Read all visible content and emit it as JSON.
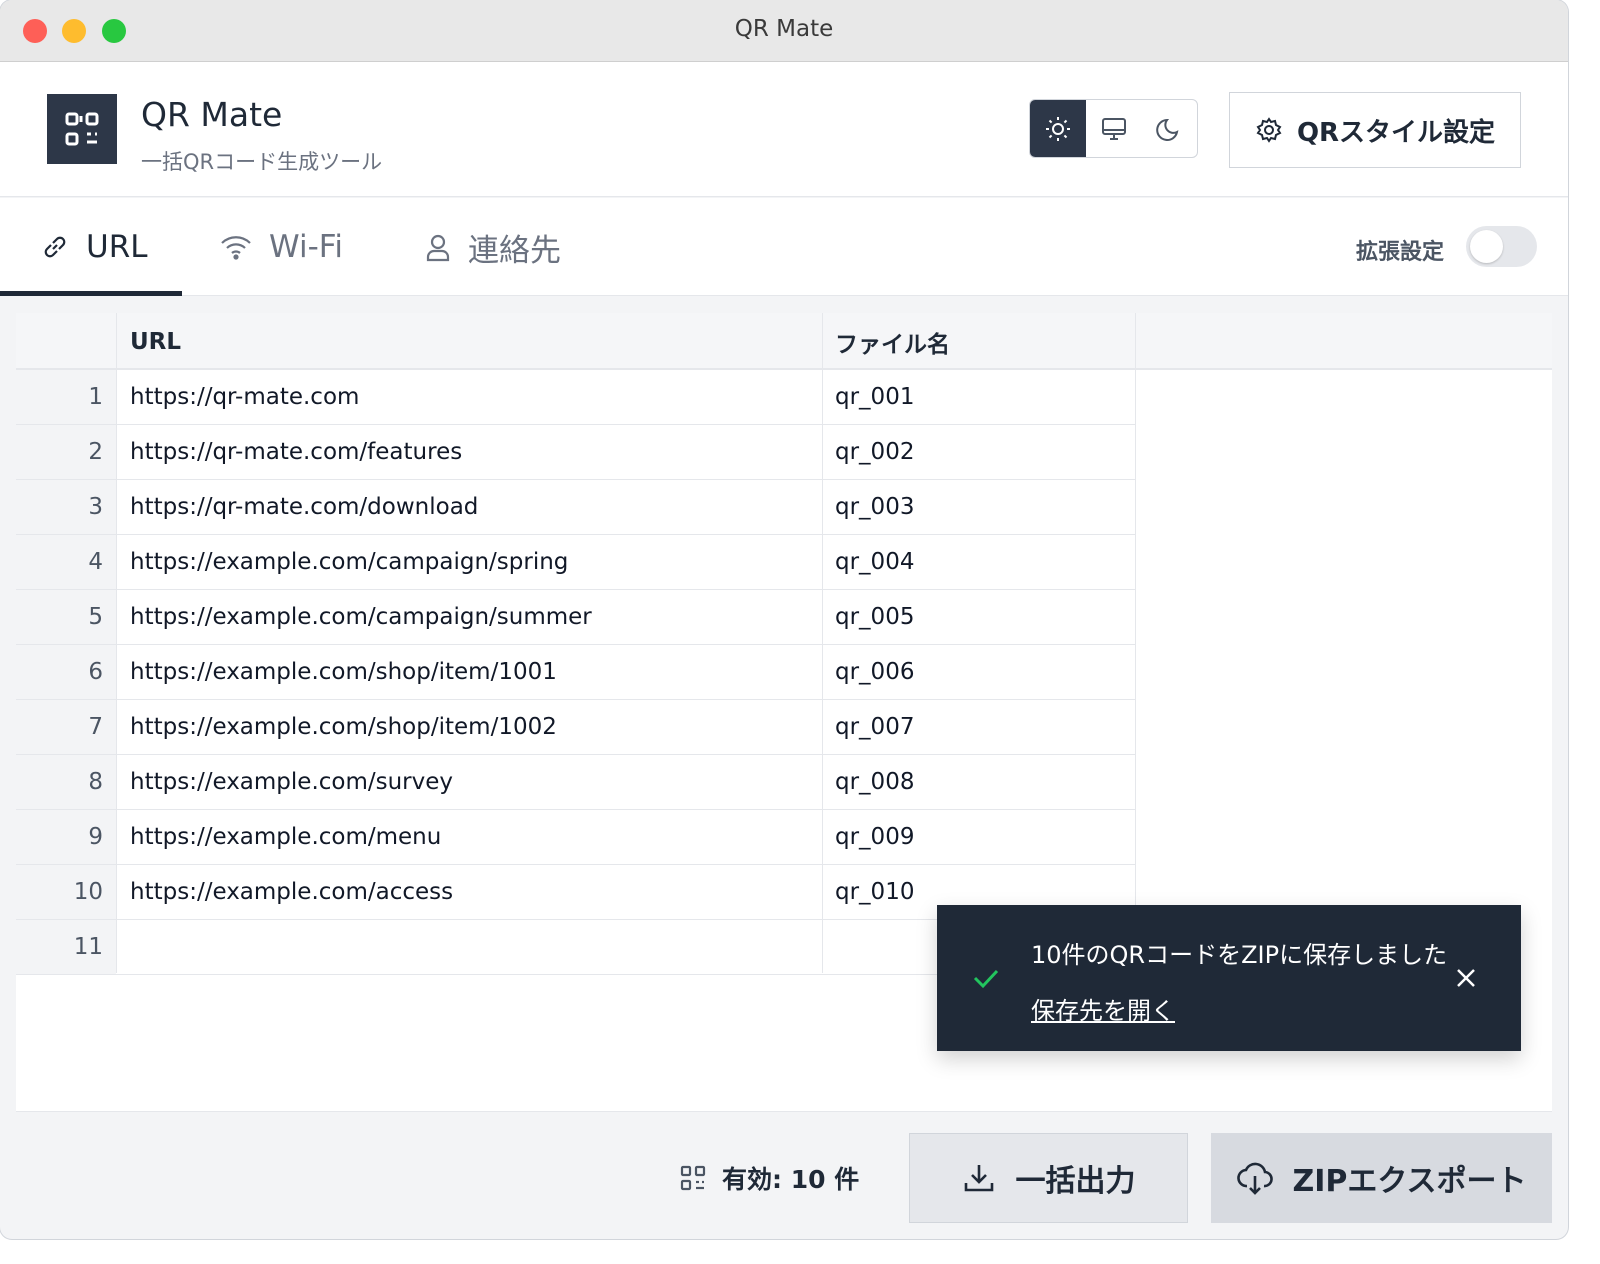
{
  "window": {
    "title": "QR Mate"
  },
  "header": {
    "app_name": "QR Mate",
    "app_subtitle": "一括QRコード生成ツール",
    "style_button_label": "QRスタイル設定",
    "theme_options": [
      "light",
      "system",
      "dark"
    ],
    "theme_selected": "light"
  },
  "tabs": [
    {
      "label": "URL",
      "icon": "link-icon",
      "active": true
    },
    {
      "label": "Wi-Fi",
      "icon": "wifi-icon",
      "active": false
    },
    {
      "label": "連絡先",
      "icon": "user-icon",
      "active": false
    }
  ],
  "extended_settings": {
    "label": "拡張設定",
    "enabled": false
  },
  "grid": {
    "columns": [
      "URL",
      "ファイル名"
    ],
    "rows": [
      {
        "num": "1",
        "url": "https://qr-mate.com",
        "file": "qr_001"
      },
      {
        "num": "2",
        "url": "https://qr-mate.com/features",
        "file": "qr_002"
      },
      {
        "num": "3",
        "url": "https://qr-mate.com/download",
        "file": "qr_003"
      },
      {
        "num": "4",
        "url": "https://example.com/campaign/spring",
        "file": "qr_004"
      },
      {
        "num": "5",
        "url": "https://example.com/campaign/summer",
        "file": "qr_005"
      },
      {
        "num": "6",
        "url": "https://example.com/shop/item/1001",
        "file": "qr_006"
      },
      {
        "num": "7",
        "url": "https://example.com/shop/item/1002",
        "file": "qr_007"
      },
      {
        "num": "8",
        "url": "https://example.com/survey",
        "file": "qr_008"
      },
      {
        "num": "9",
        "url": "https://example.com/menu",
        "file": "qr_009"
      },
      {
        "num": "10",
        "url": "https://example.com/access",
        "file": "qr_010"
      },
      {
        "num": "11",
        "url": "",
        "file": ""
      }
    ]
  },
  "toast": {
    "message": "10件のQRコードをZIPに保存しました",
    "link_label": "保存先を開く",
    "status_color": "#22c55e"
  },
  "footer": {
    "valid_count_label": "有効: 10 件",
    "bulk_button_label": "一括出力",
    "zip_button_label": "ZIPエクスポート"
  }
}
